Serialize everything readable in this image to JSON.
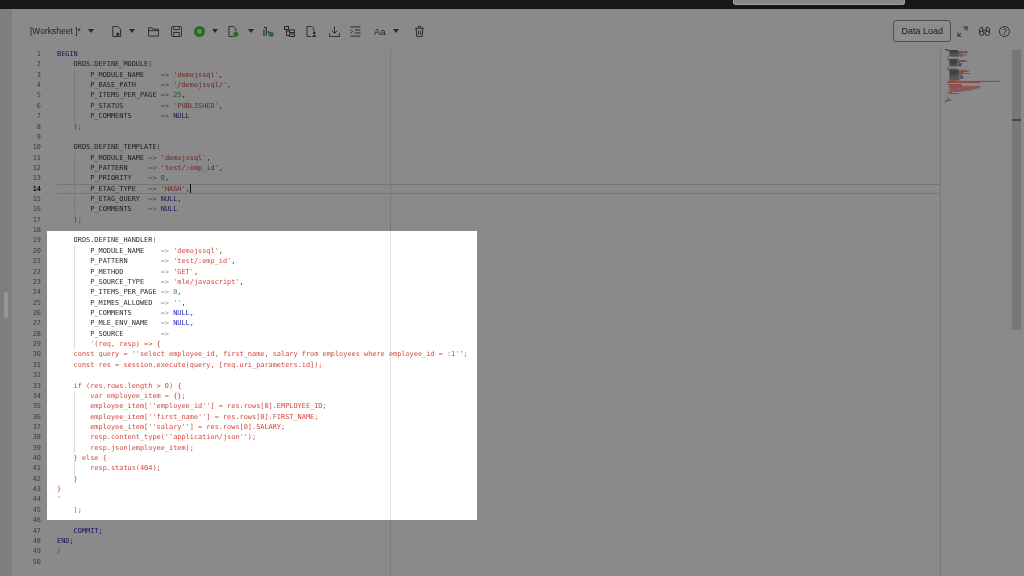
{
  "toolbar": {
    "worksheet_menu": "[Worksheet ]*",
    "font_menu": "Aa",
    "data_load_button": "Data Load"
  },
  "editor": {
    "sections": [
      {
        "kind": "dimmed",
        "lines": [
          {
            "number": "1",
            "current": false,
            "tokens": [
              {
                "kind": "keyword",
                "text": "BEGIN"
              }
            ]
          },
          {
            "number": "2",
            "current": false,
            "tokens": [
              {
                "kind": "plain",
                "text": "    ORDS.DEFINE_MODULE"
              },
              {
                "kind": "bracket",
                "text": "("
              }
            ]
          },
          {
            "number": "3",
            "current": false,
            "tokens": [
              {
                "kind": "plain",
                "text": "        P_MODULE_NAME    "
              },
              {
                "kind": "operator",
                "text": "=> "
              },
              {
                "kind": "string",
                "text": "'demojssql'"
              },
              {
                "kind": "plain",
                "text": ","
              }
            ]
          },
          {
            "number": "4",
            "current": false,
            "tokens": [
              {
                "kind": "plain",
                "text": "        P_BASE_PATH      "
              },
              {
                "kind": "operator",
                "text": "=> "
              },
              {
                "kind": "string",
                "text": "'/demojssql/'"
              },
              {
                "kind": "plain",
                "text": ","
              }
            ]
          },
          {
            "number": "5",
            "current": false,
            "tokens": [
              {
                "kind": "plain",
                "text": "        P_ITEMS_PER_PAGE "
              },
              {
                "kind": "operator",
                "text": "=> "
              },
              {
                "kind": "number",
                "text": "25"
              },
              {
                "kind": "plain",
                "text": ","
              }
            ]
          },
          {
            "number": "6",
            "current": false,
            "tokens": [
              {
                "kind": "plain",
                "text": "        P_STATUS         "
              },
              {
                "kind": "operator",
                "text": "=> "
              },
              {
                "kind": "string",
                "text": "'PUBLISHED'"
              },
              {
                "kind": "plain",
                "text": ","
              }
            ]
          },
          {
            "number": "7",
            "current": false,
            "tokens": [
              {
                "kind": "plain",
                "text": "        P_COMMENTS       "
              },
              {
                "kind": "operator",
                "text": "=> "
              },
              {
                "kind": "keyword",
                "text": "NULL"
              }
            ]
          },
          {
            "number": "8",
            "current": false,
            "tokens": [
              {
                "kind": "bracket",
                "text": "    );"
              }
            ]
          },
          {
            "number": "9",
            "current": false
          },
          {
            "number": "10",
            "current": false,
            "tokens": [
              {
                "kind": "plain",
                "text": "    ORDS.DEFINE_TEMPLATE"
              },
              {
                "kind": "bracket",
                "text": "("
              }
            ]
          },
          {
            "number": "11",
            "current": false,
            "tokens": [
              {
                "kind": "plain",
                "text": "        P_MODULE_NAME "
              },
              {
                "kind": "operator",
                "text": "=> "
              },
              {
                "kind": "string",
                "text": "'demojssql'"
              },
              {
                "kind": "plain",
                "text": ","
              }
            ]
          },
          {
            "number": "12",
            "current": false,
            "tokens": [
              {
                "kind": "plain",
                "text": "        P_PATTERN     "
              },
              {
                "kind": "operator",
                "text": "=> "
              },
              {
                "kind": "string",
                "text": "'test/:emp_id'"
              },
              {
                "kind": "plain",
                "text": ","
              }
            ]
          },
          {
            "number": "13",
            "current": false,
            "tokens": [
              {
                "kind": "plain",
                "text": "        P_PRIORITY    "
              },
              {
                "kind": "operator",
                "text": "=> "
              },
              {
                "kind": "number",
                "text": "0"
              },
              {
                "kind": "plain",
                "text": ","
              }
            ]
          },
          {
            "number": "14",
            "current": true,
            "tokens": [
              {
                "kind": "plain",
                "text": "        P_ETAG_TYPE   "
              },
              {
                "kind": "operator",
                "text": "=> "
              },
              {
                "kind": "string",
                "text": "'HASH'"
              },
              {
                "kind": "plain",
                "text": ","
              }
            ]
          },
          {
            "number": "15",
            "current": false,
            "tokens": [
              {
                "kind": "plain",
                "text": "        P_ETAG_QUERY  "
              },
              {
                "kind": "operator",
                "text": "=> "
              },
              {
                "kind": "keyword",
                "text": "NULL"
              },
              {
                "kind": "plain",
                "text": ","
              }
            ]
          },
          {
            "number": "16",
            "current": false,
            "tokens": [
              {
                "kind": "plain",
                "text": "        P_COMMENTS    "
              },
              {
                "kind": "operator",
                "text": "=> "
              },
              {
                "kind": "keyword",
                "text": "NULL"
              }
            ]
          },
          {
            "number": "17",
            "current": false,
            "tokens": [
              {
                "kind": "bracket",
                "text": "    );"
              }
            ]
          },
          {
            "number": "18",
            "current": false
          }
        ]
      },
      {
        "kind": "spotlight",
        "lines": [
          {
            "number": "19",
            "current": false,
            "tokens": [
              {
                "kind": "plain",
                "text": "    ORDS.DEFINE_HANDLER"
              },
              {
                "kind": "bracket",
                "text": "("
              }
            ]
          },
          {
            "number": "20",
            "current": false,
            "tokens": [
              {
                "kind": "plain",
                "text": "        P_MODULE_NAME    "
              },
              {
                "kind": "operator",
                "text": "=> "
              },
              {
                "kind": "string",
                "text": "'demojssql'"
              },
              {
                "kind": "plain",
                "text": ","
              }
            ]
          },
          {
            "number": "21",
            "current": false,
            "tokens": [
              {
                "kind": "plain",
                "text": "        P_PATTERN        "
              },
              {
                "kind": "operator",
                "text": "=> "
              },
              {
                "kind": "string",
                "text": "'test/:emp_id'"
              },
              {
                "kind": "plain",
                "text": ","
              }
            ]
          },
          {
            "number": "22",
            "current": false,
            "tokens": [
              {
                "kind": "plain",
                "text": "        P_METHOD         "
              },
              {
                "kind": "operator",
                "text": "=> "
              },
              {
                "kind": "string",
                "text": "'GET'"
              },
              {
                "kind": "plain",
                "text": ","
              }
            ]
          },
          {
            "number": "23",
            "current": false,
            "tokens": [
              {
                "kind": "plain",
                "text": "        P_SOURCE_TYPE    "
              },
              {
                "kind": "operator",
                "text": "=> "
              },
              {
                "kind": "string",
                "text": "'mle/javascript'"
              },
              {
                "kind": "plain",
                "text": ","
              }
            ]
          },
          {
            "number": "24",
            "current": false,
            "tokens": [
              {
                "kind": "plain",
                "text": "        P_ITEMS_PER_PAGE "
              },
              {
                "kind": "operator",
                "text": "=> "
              },
              {
                "kind": "number",
                "text": "0"
              },
              {
                "kind": "plain",
                "text": ","
              }
            ]
          },
          {
            "number": "25",
            "current": false,
            "tokens": [
              {
                "kind": "plain",
                "text": "        P_MIMES_ALLOWED  "
              },
              {
                "kind": "operator",
                "text": "=> "
              },
              {
                "kind": "string",
                "text": "''"
              },
              {
                "kind": "plain",
                "text": ","
              }
            ]
          },
          {
            "number": "26",
            "current": false,
            "tokens": [
              {
                "kind": "plain",
                "text": "        P_COMMENTS       "
              },
              {
                "kind": "operator",
                "text": "=> "
              },
              {
                "kind": "keyword",
                "text": "NULL"
              },
              {
                "kind": "plain",
                "text": ","
              }
            ]
          },
          {
            "number": "27",
            "current": false,
            "tokens": [
              {
                "kind": "plain",
                "text": "        P_MLE_ENV_NAME   "
              },
              {
                "kind": "operator",
                "text": "=> "
              },
              {
                "kind": "keyword",
                "text": "NULL"
              },
              {
                "kind": "plain",
                "text": ","
              }
            ]
          },
          {
            "number": "28",
            "current": false,
            "tokens": [
              {
                "kind": "plain",
                "text": "        P_SOURCE         "
              },
              {
                "kind": "operator",
                "text": "=>"
              }
            ]
          },
          {
            "number": "29",
            "current": false,
            "tokens": [
              {
                "kind": "string",
                "text": "        '(req, resp) => {"
              }
            ]
          },
          {
            "number": "30",
            "current": false,
            "tokens": [
              {
                "kind": "string",
                "text": "    const query = ''select employee_id, first_name, salary from employees where employee_id = :1'';"
              }
            ]
          },
          {
            "number": "31",
            "current": false,
            "tokens": [
              {
                "kind": "string",
                "text": "    const res = session.execute(query, [req.uri_parameters.id]);"
              }
            ]
          },
          {
            "number": "32",
            "current": false
          },
          {
            "number": "33",
            "current": false,
            "tokens": [
              {
                "kind": "string",
                "text": "    if (res.rows.length > 0) {"
              }
            ]
          },
          {
            "number": "34",
            "current": false,
            "tokens": [
              {
                "kind": "string",
                "text": "        var employee_item = {};"
              }
            ]
          },
          {
            "number": "35",
            "current": false,
            "tokens": [
              {
                "kind": "string",
                "text": "        employee_item[''employee_id''] = res.rows[0].EMPLOYEE_ID;"
              }
            ]
          },
          {
            "number": "36",
            "current": false,
            "tokens": [
              {
                "kind": "string",
                "text": "        employee_item[''first_name''] = res.rows[0].FIRST_NAME;"
              }
            ]
          },
          {
            "number": "37",
            "current": false,
            "tokens": [
              {
                "kind": "string",
                "text": "        employee_item[''salary''] = res.rows[0].SALARY;"
              }
            ]
          },
          {
            "number": "38",
            "current": false,
            "tokens": [
              {
                "kind": "string",
                "text": "        resp.content_type(''application/json'');"
              }
            ]
          },
          {
            "number": "39",
            "current": false,
            "tokens": [
              {
                "kind": "string",
                "text": "        resp.json(employee_item);"
              }
            ]
          },
          {
            "number": "40",
            "current": false,
            "tokens": [
              {
                "kind": "string",
                "text": "    } else {"
              }
            ]
          },
          {
            "number": "41",
            "current": false,
            "tokens": [
              {
                "kind": "string",
                "text": "        resp.status(404);"
              }
            ]
          },
          {
            "number": "42",
            "current": false,
            "tokens": [
              {
                "kind": "string",
                "text": "    }"
              }
            ]
          },
          {
            "number": "43",
            "current": false,
            "tokens": [
              {
                "kind": "string",
                "text": "}"
              }
            ]
          },
          {
            "number": "44",
            "current": false,
            "tokens": [
              {
                "kind": "string",
                "text": "'"
              }
            ]
          },
          {
            "number": "45",
            "current": false,
            "tokens": [
              {
                "kind": "bracket",
                "text": "    );"
              }
            ]
          }
        ]
      },
      {
        "kind": "dimmed",
        "lines": [
          {
            "number": "46",
            "current": false
          },
          {
            "number": "47",
            "current": false,
            "tokens": [
              {
                "kind": "keyword",
                "text": "    COMMIT"
              },
              {
                "kind": "plain",
                "text": ";"
              }
            ]
          },
          {
            "number": "48",
            "current": false,
            "tokens": [
              {
                "kind": "keyword",
                "text": "END"
              },
              {
                "kind": "plain",
                "text": ";"
              }
            ]
          },
          {
            "number": "49",
            "current": false,
            "tokens": [
              {
                "kind": "operator",
                "text": "/"
              }
            ]
          },
          {
            "number": "50",
            "current": false
          }
        ]
      }
    ]
  }
}
